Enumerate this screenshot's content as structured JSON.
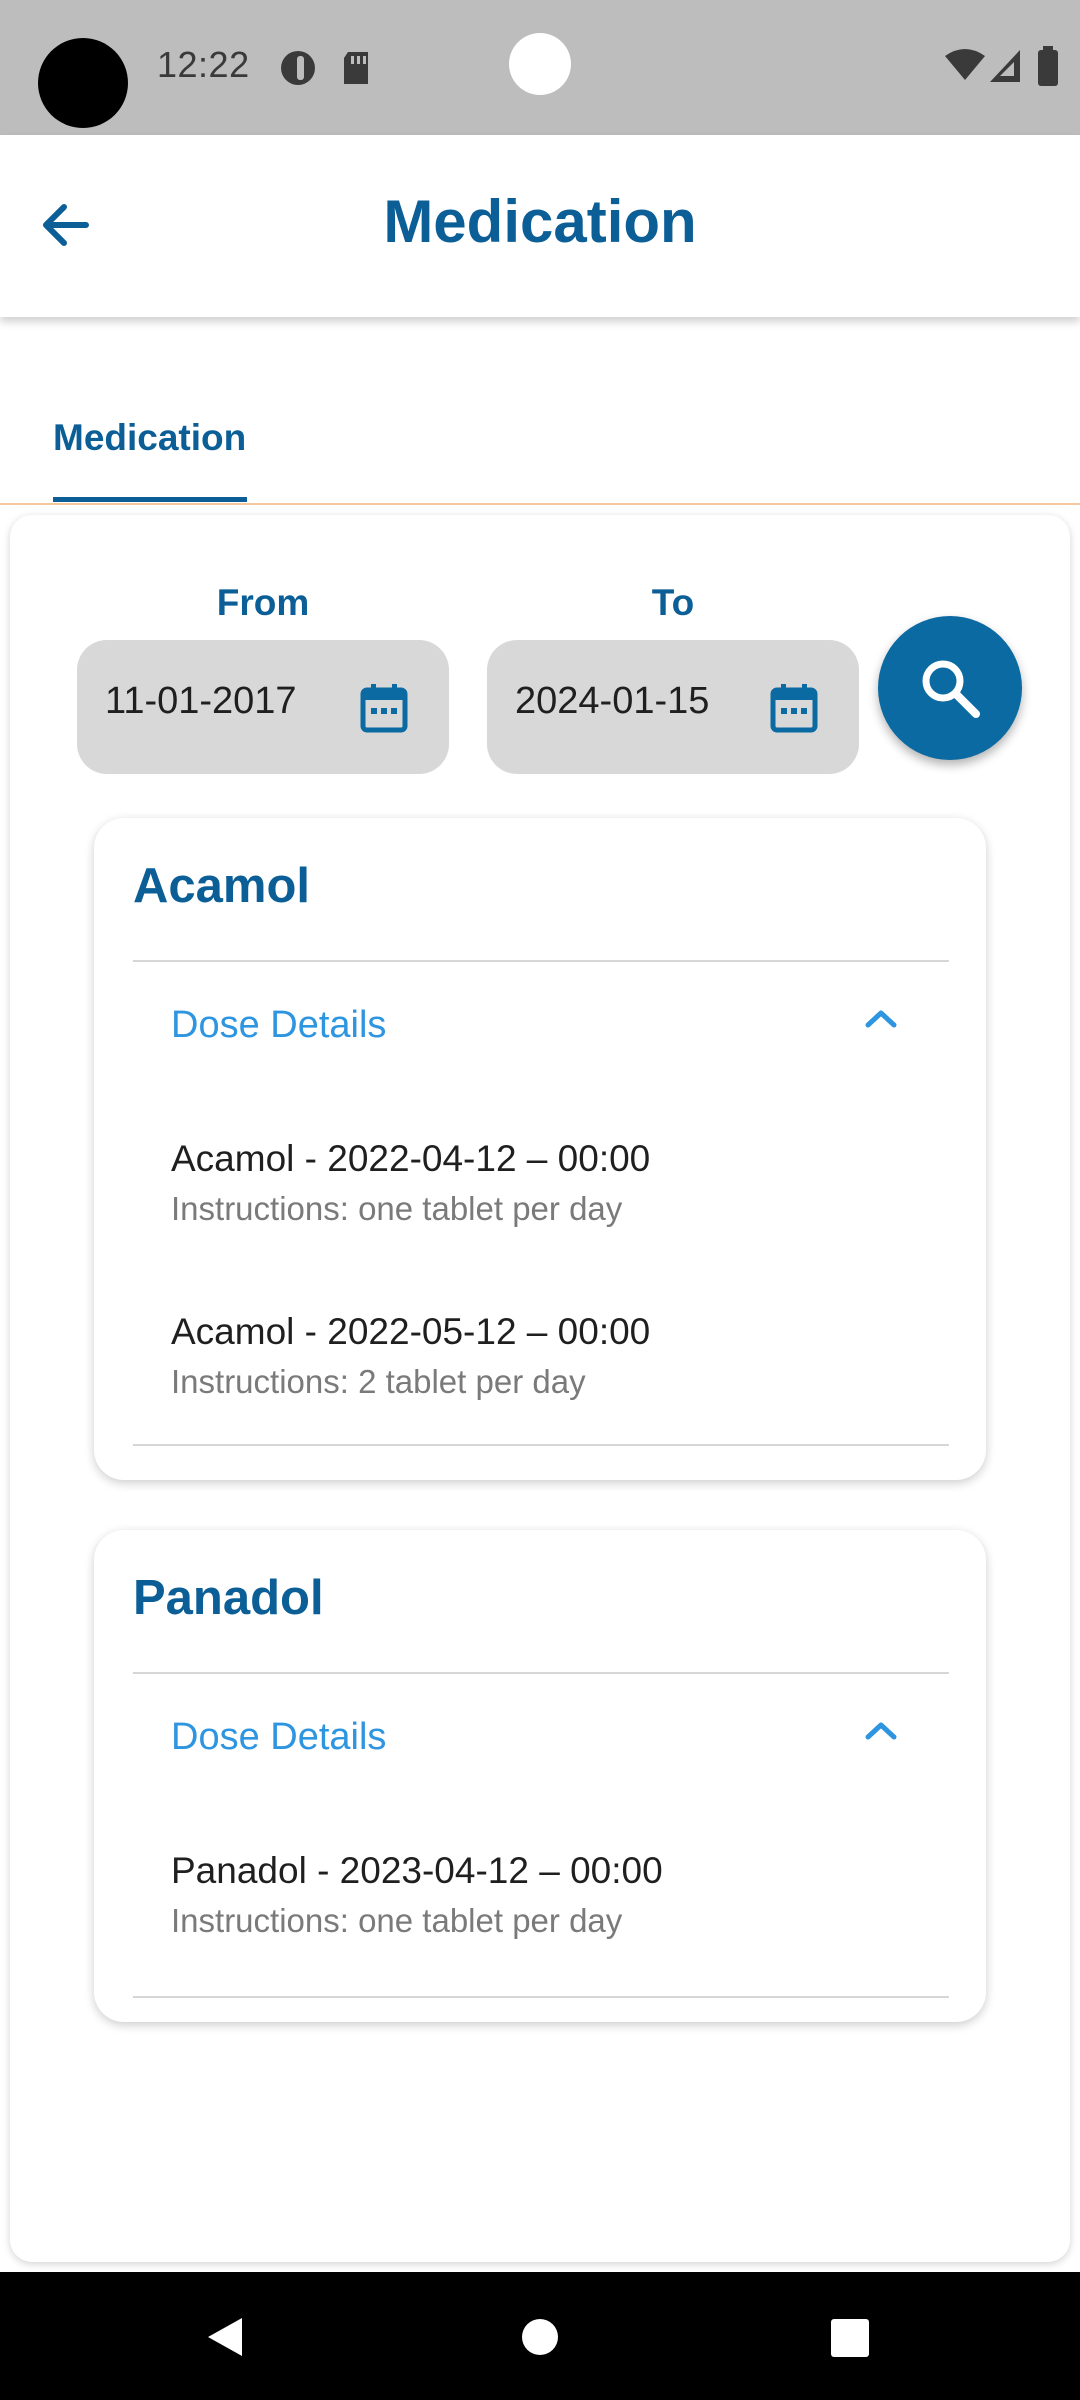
{
  "status_bar": {
    "time": "12:22"
  },
  "app_bar": {
    "title": "Medication"
  },
  "tabs": [
    {
      "label": "Medication",
      "selected": true
    }
  ],
  "filters": {
    "from_label": "From",
    "from_value": "11-01-2017",
    "to_label": "To",
    "to_value": "2024-01-15"
  },
  "medications": [
    {
      "name": "Acamol",
      "section_title": "Dose Details",
      "expanded": true,
      "doses": [
        {
          "title": "Acamol - 2022-04-12 – 00:00",
          "instructions": "Instructions: one tablet per day"
        },
        {
          "title": "Acamol - 2022-05-12 – 00:00",
          "instructions": "Instructions: 2 tablet per day"
        }
      ]
    },
    {
      "name": "Panadol",
      "section_title": "Dose Details",
      "expanded": true,
      "doses": [
        {
          "title": "Panadol - 2023-04-12 – 00:00",
          "instructions": "Instructions: one tablet per day"
        }
      ]
    }
  ],
  "colors": {
    "primary": "#0b5f96",
    "accent_link": "#2e95e0",
    "field_bg": "#d8d8d8",
    "status_bar_bg": "#bdbdbd"
  }
}
